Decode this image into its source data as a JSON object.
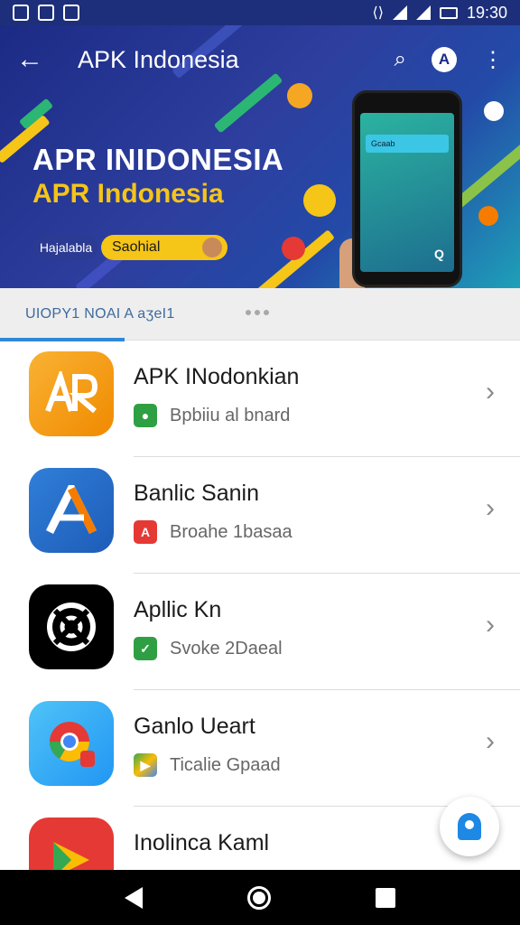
{
  "status_bar": {
    "time": "19:30"
  },
  "toolbar": {
    "back_glyph": "←",
    "title": "APK Indonesia",
    "search_glyph": "⌕",
    "logo_letter": "A",
    "overflow_glyph": "⋮"
  },
  "banner": {
    "title": "APR INIDONESIA",
    "subtitle": "APR Indonesia",
    "chip": "Hajalabla",
    "pill": "Saohial",
    "phone_bar": "Gcaab",
    "phone_icon": "Q"
  },
  "tab": {
    "label": "UIOPY1 NOAI A aʒeI1"
  },
  "apps": [
    {
      "title": "APK INodonkian",
      "subtitle": "Bpbiiu al bnard",
      "icon": "orange-ar-icon",
      "sub_color": "#2ea043"
    },
    {
      "title": "Banlic Sanin",
      "subtitle": "Broahe 1basaa",
      "icon": "blue-a-icon",
      "sub_color": "#e53935"
    },
    {
      "title": "Apllic Kn",
      "subtitle": "Svoke 2Daeal",
      "icon": "black-target-icon",
      "sub_color": "#2ea043"
    },
    {
      "title": "Ganlo Ueart",
      "subtitle": "Ticalie Gpaad",
      "icon": "chrome-icon",
      "sub_color": "#fbbc05"
    },
    {
      "title": "Inolinca Kaml",
      "subtitle": "",
      "icon": "red-play-icon",
      "sub_color": "#2ea043"
    }
  ],
  "chevron_glyph": "›",
  "colors": {
    "header": "#1b2b85",
    "accent_yellow": "#f5c518",
    "tab_indicator": "#2f88d8",
    "tab_text": "#3d6a9e"
  }
}
